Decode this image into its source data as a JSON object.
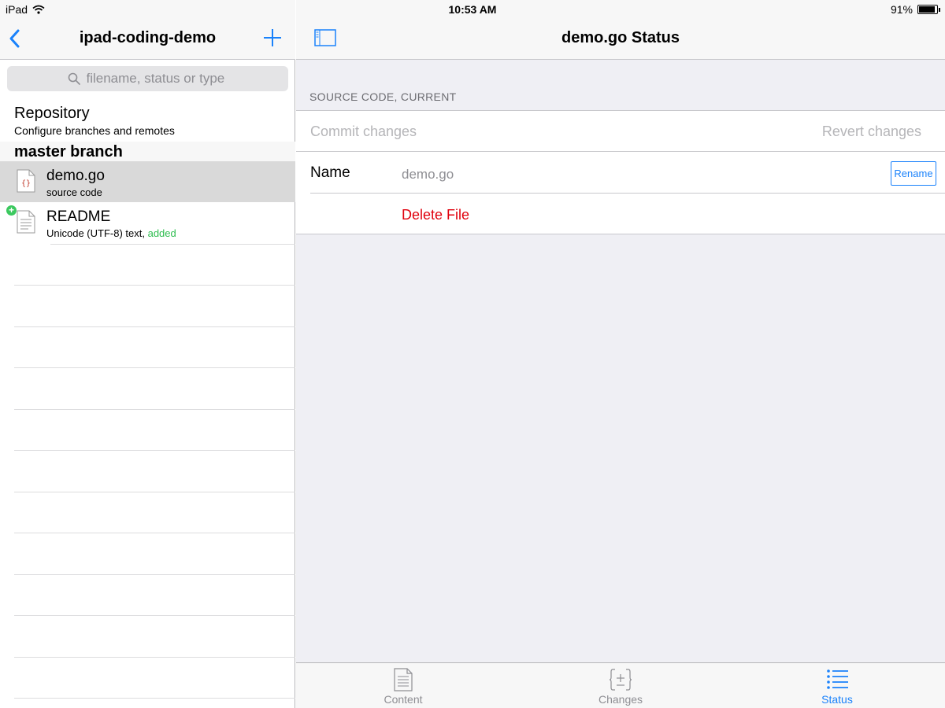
{
  "status_bar": {
    "device": "iPad",
    "time": "10:53 AM",
    "battery": "91%",
    "battery_level": 0.91
  },
  "left_pane": {
    "title": "ipad-coding-demo",
    "back_icon": "chevron-left-icon",
    "add_icon": "plus-icon",
    "search": {
      "placeholder": "filename, status or type",
      "value": ""
    },
    "repository": {
      "title": "Repository",
      "subtitle": "Configure branches and remotes"
    },
    "section": "master branch",
    "files": [
      {
        "name": "demo.go",
        "subtitle": "source code",
        "status": "",
        "selected": true,
        "icon": "code-file-icon"
      },
      {
        "name": "README",
        "subtitle": "Unicode (UTF-8) text, ",
        "status": "added",
        "selected": false,
        "icon": "text-file-icon"
      }
    ]
  },
  "right_pane": {
    "title": "demo.go Status",
    "sidebar_toggle_icon": "sidebar-toggle-icon",
    "group_header": "SOURCE CODE, CURRENT",
    "commit_label": "Commit changes",
    "revert_label": "Revert changes",
    "name_label": "Name",
    "name_value": "demo.go",
    "rename_label": "Rename",
    "delete_label": "Delete File"
  },
  "tabbar": {
    "tabs": [
      {
        "label": "Content",
        "icon": "document-icon",
        "active": false
      },
      {
        "label": "Changes",
        "icon": "diff-icon",
        "active": false
      },
      {
        "label": "Status",
        "icon": "list-icon",
        "active": true
      }
    ]
  },
  "colors": {
    "accent": "#1a82fb",
    "destructive": "#e0000d",
    "added": "#2ebd4f",
    "selected_row": "#d9d9d9",
    "disabled_text": "#b5b5b8"
  }
}
